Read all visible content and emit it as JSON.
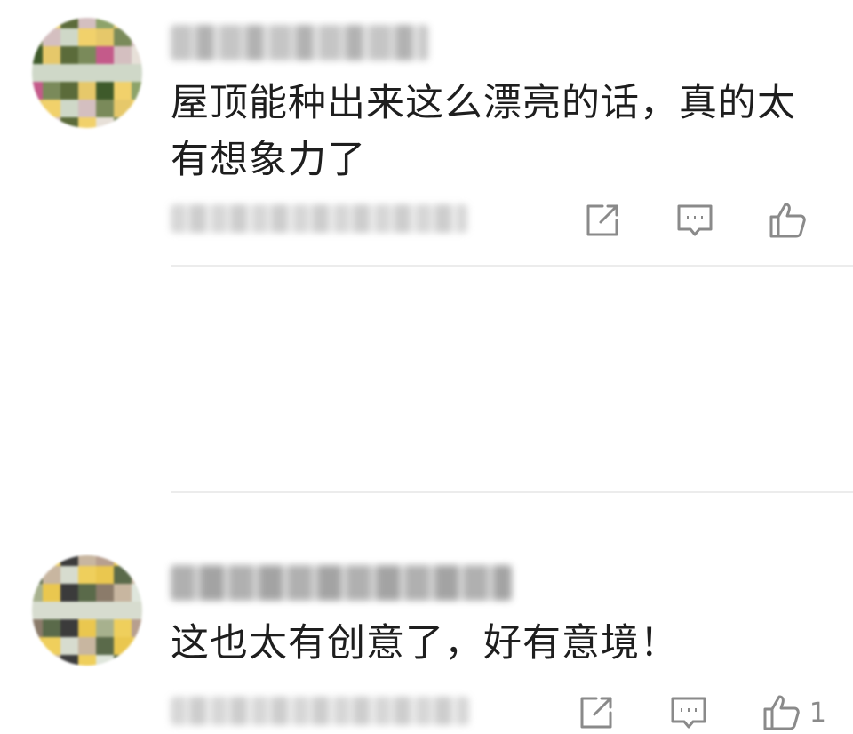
{
  "comments": [
    {
      "author_name": "",
      "text": "屋顶能种出来这么漂亮的话，真的太有想象力了",
      "meta": "",
      "like_count": "",
      "avatar_colors": [
        "#e7e0d8",
        "#d4bfc0",
        "#c45a8a",
        "#7a8a5a",
        "#5b6b3a",
        "#e6c86a",
        "#3e5a2a",
        "#f1d16b",
        "#8da36a",
        "#cfd8c8"
      ]
    },
    {
      "author_name": "",
      "text": "这也太有创意了，好有意境！",
      "meta": "",
      "like_count": "1",
      "avatar_colors": [
        "#dfe6dc",
        "#c8b6a0",
        "#8b7b6a",
        "#5a6a4a",
        "#3b3b3b",
        "#eac74f",
        "#a7b18e",
        "#efcf5c",
        "#b79f8f",
        "#d7dccf"
      ]
    }
  ],
  "icons": {
    "share": "share-icon",
    "reply": "reply-comment-icon",
    "like": "thumbs-up-icon"
  },
  "colors": {
    "text": "#1e1e1e",
    "icon": "#8a8a8a",
    "divider": "#ececec"
  }
}
